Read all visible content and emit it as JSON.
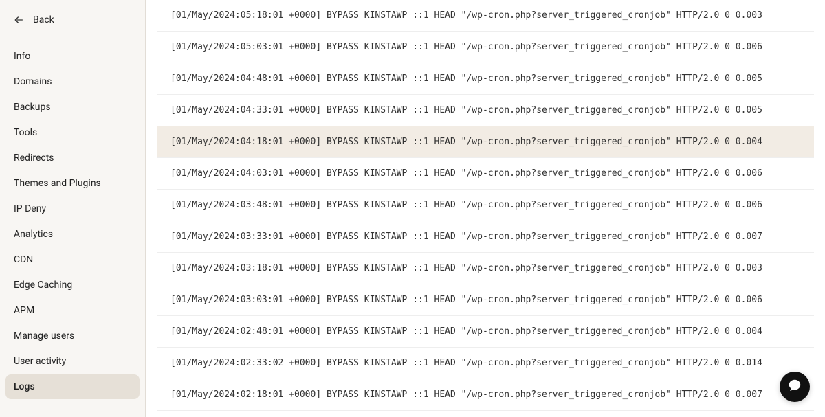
{
  "back": {
    "label": "Back"
  },
  "sidebar": {
    "items": [
      {
        "label": "Info",
        "active": false
      },
      {
        "label": "Domains",
        "active": false
      },
      {
        "label": "Backups",
        "active": false
      },
      {
        "label": "Tools",
        "active": false
      },
      {
        "label": "Redirects",
        "active": false
      },
      {
        "label": "Themes and Plugins",
        "active": false
      },
      {
        "label": "IP Deny",
        "active": false
      },
      {
        "label": "Analytics",
        "active": false
      },
      {
        "label": "CDN",
        "active": false
      },
      {
        "label": "Edge Caching",
        "active": false
      },
      {
        "label": "APM",
        "active": false
      },
      {
        "label": "Manage users",
        "active": false
      },
      {
        "label": "User activity",
        "active": false
      },
      {
        "label": "Logs",
        "active": true
      }
    ]
  },
  "logs": [
    {
      "text": "[01/May/2024:05:18:01 +0000] BYPASS KINSTAWP ::1 HEAD \"/wp-cron.php?server_triggered_cronjob\" HTTP/2.0 0 0.003",
      "highlighted": false
    },
    {
      "text": "[01/May/2024:05:03:01 +0000] BYPASS KINSTAWP ::1 HEAD \"/wp-cron.php?server_triggered_cronjob\" HTTP/2.0 0 0.006",
      "highlighted": false
    },
    {
      "text": "[01/May/2024:04:48:01 +0000] BYPASS KINSTAWP ::1 HEAD \"/wp-cron.php?server_triggered_cronjob\" HTTP/2.0 0 0.005",
      "highlighted": false
    },
    {
      "text": "[01/May/2024:04:33:01 +0000] BYPASS KINSTAWP ::1 HEAD \"/wp-cron.php?server_triggered_cronjob\" HTTP/2.0 0 0.005",
      "highlighted": false
    },
    {
      "text": "[01/May/2024:04:18:01 +0000] BYPASS KINSTAWP ::1 HEAD \"/wp-cron.php?server_triggered_cronjob\" HTTP/2.0 0 0.004",
      "highlighted": true
    },
    {
      "text": "[01/May/2024:04:03:01 +0000] BYPASS KINSTAWP ::1 HEAD \"/wp-cron.php?server_triggered_cronjob\" HTTP/2.0 0 0.006",
      "highlighted": false
    },
    {
      "text": "[01/May/2024:03:48:01 +0000] BYPASS KINSTAWP ::1 HEAD \"/wp-cron.php?server_triggered_cronjob\" HTTP/2.0 0 0.006",
      "highlighted": false
    },
    {
      "text": "[01/May/2024:03:33:01 +0000] BYPASS KINSTAWP ::1 HEAD \"/wp-cron.php?server_triggered_cronjob\" HTTP/2.0 0 0.007",
      "highlighted": false
    },
    {
      "text": "[01/May/2024:03:18:01 +0000] BYPASS KINSTAWP ::1 HEAD \"/wp-cron.php?server_triggered_cronjob\" HTTP/2.0 0 0.003",
      "highlighted": false
    },
    {
      "text": "[01/May/2024:03:03:01 +0000] BYPASS KINSTAWP ::1 HEAD \"/wp-cron.php?server_triggered_cronjob\" HTTP/2.0 0 0.006",
      "highlighted": false
    },
    {
      "text": "[01/May/2024:02:48:01 +0000] BYPASS KINSTAWP ::1 HEAD \"/wp-cron.php?server_triggered_cronjob\" HTTP/2.0 0 0.004",
      "highlighted": false
    },
    {
      "text": "[01/May/2024:02:33:02 +0000] BYPASS KINSTAWP ::1 HEAD \"/wp-cron.php?server_triggered_cronjob\" HTTP/2.0 0 0.014",
      "highlighted": false
    },
    {
      "text": "[01/May/2024:02:18:01 +0000] BYPASS KINSTAWP ::1 HEAD \"/wp-cron.php?server_triggered_cronjob\" HTTP/2.0 0 0.007",
      "highlighted": false
    }
  ]
}
